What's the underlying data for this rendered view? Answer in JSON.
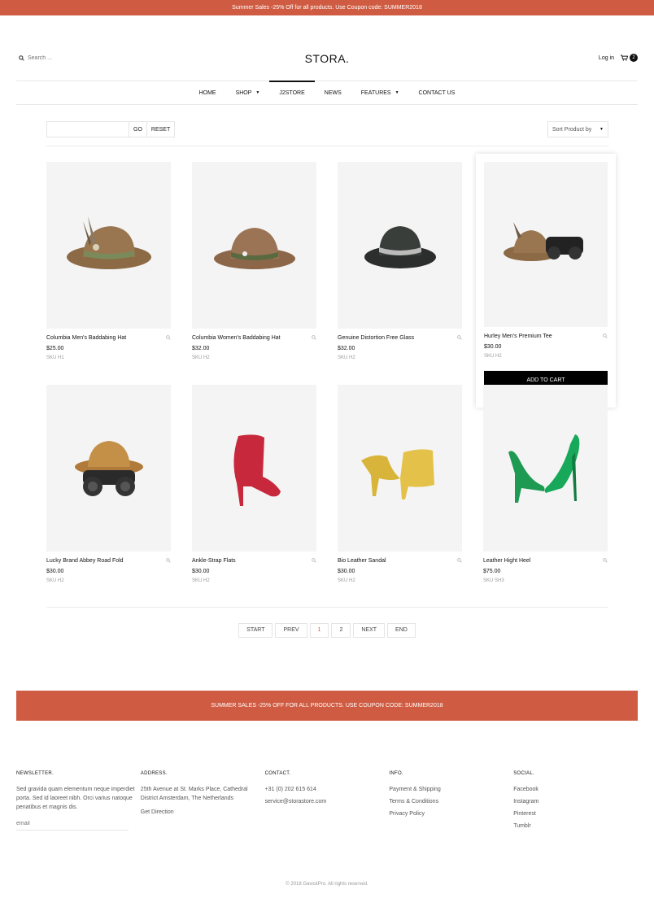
{
  "topbar": {
    "text": "Summer Sales -25% Off for all products. Use Coupon code: SUMMER2018"
  },
  "header": {
    "search_placeholder": "Search ...",
    "logo": "STORA.",
    "login": "Log in",
    "cart_count": "2"
  },
  "nav": {
    "items": [
      {
        "label": "HOME"
      },
      {
        "label": "SHOP"
      },
      {
        "label": "J2STORE"
      },
      {
        "label": "NEWS"
      },
      {
        "label": "FEATURES"
      },
      {
        "label": "CONTACT US"
      }
    ]
  },
  "toolbar": {
    "go": "GO",
    "reset": "RESET",
    "sort": "Sort Product by"
  },
  "products": [
    {
      "name": "Columbia Men's Baddabing Hat",
      "price": "$25.00",
      "sku": "SKU H1",
      "image": "hat-feather"
    },
    {
      "name": "Columbia Women's Baddabing Hat",
      "price": "$32.00",
      "sku": "SKU H2",
      "image": "hat-brown"
    },
    {
      "name": "Genuine Distortion Free Glass",
      "price": "$32.00",
      "sku": "SKU H2",
      "image": "hat-black"
    },
    {
      "name": "Hurley Men's Premium Tee",
      "price": "$30.00",
      "sku": "SKU H2",
      "image": "hat-binoculars",
      "add_to_cart": "ADD TO CART"
    },
    {
      "name": "Lucky Brand Abbey Road Fold",
      "price": "$30.00",
      "sku": "SKU H2",
      "image": "hat-binoculars-2"
    },
    {
      "name": "Ankle-Strap Flats",
      "price": "$30.00",
      "sku": "SKU H2",
      "image": "red-boot"
    },
    {
      "name": "Bio Leather Sandal",
      "price": "$30.00",
      "sku": "SKU H2",
      "image": "yellow-bootie"
    },
    {
      "name": "Leather Hight Heel",
      "price": "$75.00",
      "sku": "SKU SH3",
      "image": "green-heels"
    }
  ],
  "pagination": {
    "start": "START",
    "prev": "PREV",
    "page1": "1",
    "page2": "2",
    "next": "NEXT",
    "end": "END"
  },
  "promo": {
    "text": "SUMMER SALES -25% OFF FOR ALL PRODUCTS. USE COUPON CODE: SUMMER2018"
  },
  "footer": {
    "newsletter": {
      "title": "NEWSLETTER.",
      "text": "Sed gravida quam elementum neque imperdiet porta. Sed id laoreet nibh. Orci varius natoque penatibus et magnis dis.",
      "email_placeholder": "email"
    },
    "address": {
      "title": "ADDRESS.",
      "text": "25th Avenue at St. Marks Place, Cathedral District Amsterdam, The Netherlands",
      "link": "Get Direction"
    },
    "contact": {
      "title": "CONTACT.",
      "phone": "+31 (0) 202 615 614",
      "email": "service@storastore.com"
    },
    "info": {
      "title": "INFO.",
      "links": [
        "Payment & Shipping",
        "Terms & Conditions",
        "Privacy Policy"
      ]
    },
    "social": {
      "title": "SOCIAL.",
      "links": [
        "Facebook",
        "Instagram",
        "Pinterest",
        "Tumblr"
      ]
    }
  },
  "copyright": "© 2018 GavickPro. All rights reserved.",
  "colors": {
    "accent": "#cf5c42",
    "dark": "#111111"
  }
}
